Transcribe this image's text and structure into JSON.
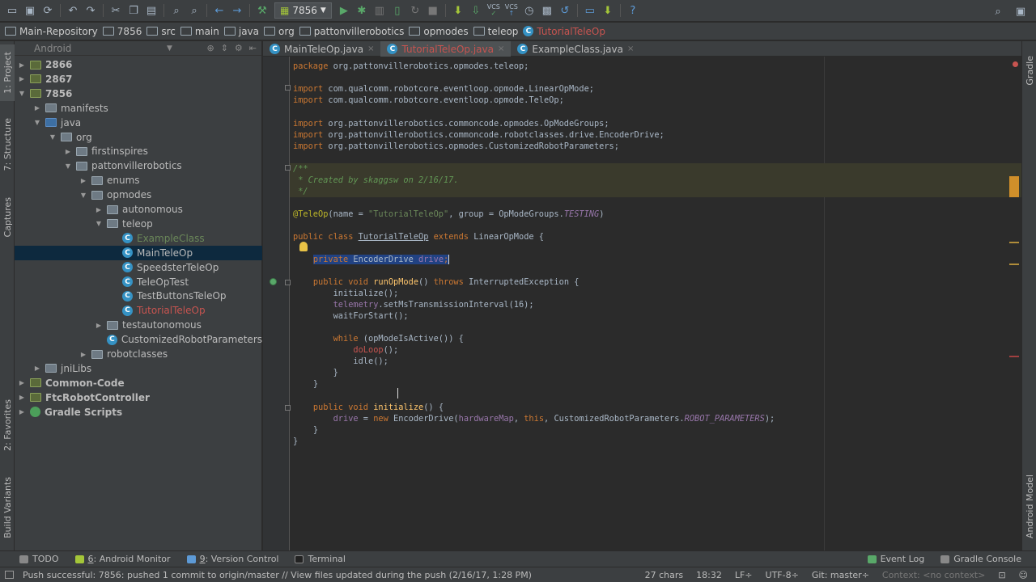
{
  "toolbar": {
    "run_config": "7856",
    "icons_left": [
      "open-icon",
      "save-icon",
      "sync-icon",
      "undo-icon",
      "redo-icon",
      "cut-icon",
      "copy-icon",
      "paste-icon",
      "find-icon",
      "replace-icon",
      "back-icon",
      "forward-icon",
      "build-icon"
    ],
    "icons_run": [
      "run-icon",
      "debug-icon",
      "coverage-icon",
      "attach-icon",
      "rerun-icon",
      "stop-icon",
      "sdk-icon",
      "vcs-update-icon",
      "vcs-commit-icon",
      "vcs-push-icon",
      "history-icon",
      "revert-icon",
      "device-icon",
      "avd-icon",
      "help-icon"
    ],
    "vcs_label_1": "VCS",
    "vcs_label_2": "VCS"
  },
  "breadcrumbs": [
    "Main-Repository",
    "7856",
    "src",
    "main",
    "java",
    "org",
    "pattonvillerobotics",
    "opmodes",
    "teleop",
    "TutorialTeleOp"
  ],
  "left_strip": {
    "project": "1: Project",
    "structure": "7: Structure",
    "captures": "Captures",
    "favorites": "2: Favorites",
    "build_variants": "Build Variants"
  },
  "right_strip": {
    "gradle": "Gradle",
    "android_model": "Android Model"
  },
  "project": {
    "view_mode": "Android",
    "tree": [
      {
        "label": "2866",
        "depth": 0,
        "arrow": "▶",
        "icon": "module"
      },
      {
        "label": "2867",
        "depth": 0,
        "arrow": "▶",
        "icon": "module"
      },
      {
        "label": "7856",
        "depth": 0,
        "arrow": "▼",
        "icon": "module"
      },
      {
        "label": "manifests",
        "depth": 1,
        "arrow": "▶",
        "icon": "folder"
      },
      {
        "label": "java",
        "depth": 1,
        "arrow": "▼",
        "icon": "src"
      },
      {
        "label": "org",
        "depth": 2,
        "arrow": "▼",
        "icon": "folder"
      },
      {
        "label": "firstinspires",
        "depth": 3,
        "arrow": "▶",
        "icon": "folder"
      },
      {
        "label": "pattonvillerobotics",
        "depth": 3,
        "arrow": "▼",
        "icon": "folder"
      },
      {
        "label": "enums",
        "depth": 4,
        "arrow": "▶",
        "icon": "folder"
      },
      {
        "label": "opmodes",
        "depth": 4,
        "arrow": "▼",
        "icon": "folder"
      },
      {
        "label": "autonomous",
        "depth": 5,
        "arrow": "▶",
        "icon": "folder"
      },
      {
        "label": "teleop",
        "depth": 5,
        "arrow": "▼",
        "icon": "folder"
      },
      {
        "label": "ExampleClass",
        "depth": 6,
        "arrow": "",
        "icon": "class",
        "color": "#6a8759"
      },
      {
        "label": "MainTeleOp",
        "depth": 6,
        "arrow": "",
        "icon": "class",
        "selected": true
      },
      {
        "label": "SpeedsterTeleOp",
        "depth": 6,
        "arrow": "",
        "icon": "class"
      },
      {
        "label": "TeleOpTest",
        "depth": 6,
        "arrow": "",
        "icon": "class"
      },
      {
        "label": "TestButtonsTeleOp",
        "depth": 6,
        "arrow": "",
        "icon": "class"
      },
      {
        "label": "TutorialTeleOp",
        "depth": 6,
        "arrow": "",
        "icon": "class",
        "color": "#c75450"
      },
      {
        "label": "testautonomous",
        "depth": 5,
        "arrow": "▶",
        "icon": "folder"
      },
      {
        "label": "CustomizedRobotParameters",
        "depth": 5,
        "arrow": "",
        "icon": "class"
      },
      {
        "label": "robotclasses",
        "depth": 4,
        "arrow": "▶",
        "icon": "folder"
      },
      {
        "label": "jniLibs",
        "depth": 1,
        "arrow": "▶",
        "icon": "folder"
      },
      {
        "label": "Common-Code",
        "depth": 0,
        "arrow": "▶",
        "icon": "module"
      },
      {
        "label": "FtcRobotController",
        "depth": 0,
        "arrow": "▶",
        "icon": "module"
      },
      {
        "label": "Gradle Scripts",
        "depth": 0,
        "arrow": "▶",
        "icon": "gradle"
      }
    ]
  },
  "tabs": [
    {
      "label": "MainTeleOp.java",
      "active": false,
      "red": false
    },
    {
      "label": "TutorialTeleOp.java",
      "active": true,
      "red": true
    },
    {
      "label": "ExampleClass.java",
      "active": false,
      "red": false
    }
  ],
  "code": {
    "pkg_kw": "package",
    "pkg_name": " org.pattonvillerobotics.opmodes.teleop;",
    "imp_kw": "import",
    "imports_1": [
      " com.qualcomm.robotcore.eventloop.opmode.LinearOpMode;",
      " com.qualcomm.robotcore.eventloop.opmode.TeleOp;"
    ],
    "imports_2": [
      " org.pattonvillerobotics.commoncode.opmodes.OpModeGroups;",
      " org.pattonvillerobotics.commoncode.robotclasses.drive.EncoderDrive;",
      " org.pattonvillerobotics.opmodes.CustomizedRobotParameters;"
    ],
    "doc_open": "/**",
    "doc_body": " * Created by skaggsw on 2/16/17.",
    "doc_close": " */",
    "ann_name": "@TeleOp",
    "ann_p1": "(name = ",
    "ann_str": "\"TutorialTeleOp\"",
    "ann_p2": ", group = OpModeGroups.",
    "ann_const": "TESTING",
    "ann_p3": ")",
    "class_kw": "public class",
    "class_name": "TutorialTeleOp",
    "extends_kw": "extends",
    "class_rest": " LinearOpMode {",
    "field_kw": "private",
    "field_type": " EncoderDrive ",
    "field_name": "drive",
    "field_end": ";",
    "run_kw": "public void",
    "run_name": "runOpMode",
    "run_p": "() ",
    "throws_kw": "throws",
    "run_rest": " InterruptedException {",
    "l_init": "initialize();",
    "l_tel_field": "telemetry",
    "l_tel_rest": ".setMsTransmissionInterval(16);",
    "l_wait": "waitForStart();",
    "while_kw": "while",
    "while_rest": " (opModeIsActive()) {",
    "l_doloop": "doLoop",
    "l_doloop_rest": "();",
    "l_idle": "idle();",
    "close_inner": "}",
    "close_method": "}",
    "init_kw": "public void",
    "init_name": "initialize",
    "init_rest": "() {",
    "assign_field": "drive",
    "assign_eq": " = ",
    "new_kw": "new",
    "assign_call": " EncoderDrive(",
    "assign_arg1": "hardwareMap",
    "assign_sep": ", ",
    "this_kw": "this",
    "assign_arg3": ", CustomizedRobotParameters.",
    "assign_const": "ROBOT_PARAMETERS",
    "assign_end": ");",
    "close_init": "}",
    "close_class": "}"
  },
  "bottom_tools": {
    "todo": "TODO",
    "monitor_num": "6",
    "monitor": ": Android Monitor",
    "vc_num": "9",
    "vc": ": Version Control",
    "terminal": "Terminal",
    "event_log": "Event Log",
    "gradle_console": "Gradle Console"
  },
  "status": {
    "message": "Push successful: 7856: pushed 1 commit to origin/master // View files updated during the push (2/16/17, 1:28 PM)",
    "chars": "27 chars",
    "position": "18:32",
    "line_sep": "LF÷",
    "encoding": "UTF-8÷",
    "git": "Git: master÷",
    "context": "Context: <no context>"
  },
  "colors": {
    "background": "#2b2b2b",
    "panel": "#3c3f41",
    "selection": "#0d293e",
    "keyword": "#cc7832",
    "string": "#6a8759",
    "annotation": "#bbb529",
    "field": "#9876aa",
    "error": "#c75450"
  }
}
